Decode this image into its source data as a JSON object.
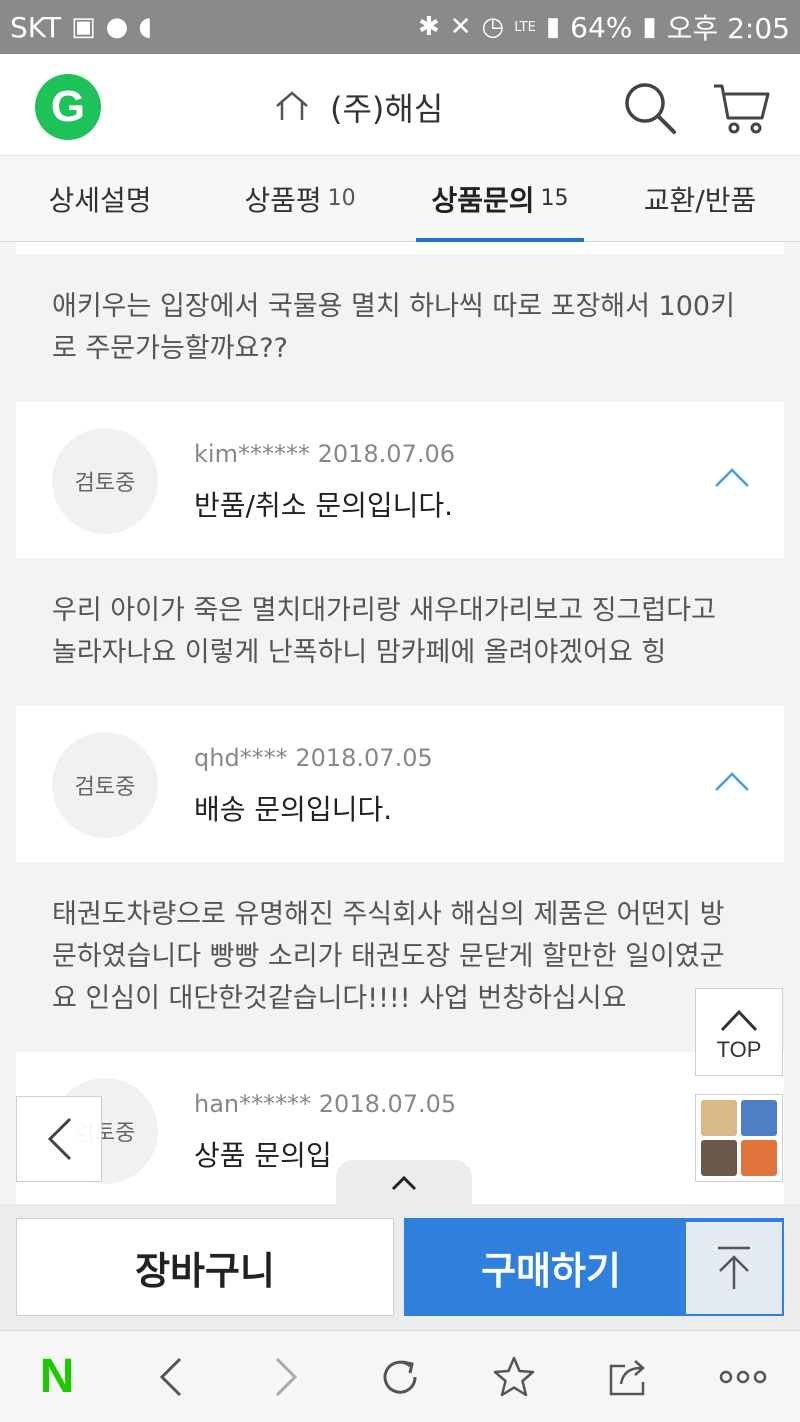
{
  "status_bar": {
    "carrier": "SKT",
    "network": "LTE",
    "battery": "64%",
    "time": "오후 2:05"
  },
  "header": {
    "logo_letter": "G",
    "store_name": "(주)해심"
  },
  "tabs": [
    {
      "label": "상세설명",
      "count": ""
    },
    {
      "label": "상품평",
      "count": "10"
    },
    {
      "label": "상품문의",
      "count": "15",
      "active": true
    },
    {
      "label": "교환/반품",
      "count": ""
    }
  ],
  "qna": {
    "first_answer": "애키우는 입장에서 국물용 멸치 하나씩 따로 포장해서 100키로 주문가능할까요??",
    "items": [
      {
        "status": "검토중",
        "author": "kim******",
        "date": "2018.07.06",
        "subject": "반품/취소 문의입니다.",
        "body": "우리 아이가 죽은 멸치대가리랑 새우대가리보고 징그럽다고 놀라자나요 이렇게 난폭하니 맘카페에 올려야겠어요 힝"
      },
      {
        "status": "검토중",
        "author": "qhd****",
        "date": "2018.07.05",
        "subject": "배송 문의입니다.",
        "body": "태권도차량으로 유명해진 주식회사 해심의 제품은 어떤지 방문하였습니다 빵빵 소리가 태권도장 문닫게 할만한 일이였군요 인심이 대단한것같습니다!!!! 사업 번창하십시요"
      },
      {
        "status": "검토중",
        "author": "han******",
        "date": "2018.07.05",
        "subject": "상품 문의입"
      }
    ]
  },
  "floating": {
    "top_label": "TOP"
  },
  "actions": {
    "cart_label": "장바구니",
    "buy_label": "구매하기"
  },
  "browser_nav": {
    "home_letter": "N"
  },
  "colors": {
    "brand_green": "#1dc25a",
    "accent_blue": "#2f80dc",
    "tab_indicator": "#1f74d4",
    "naver_green": "#1ec800"
  },
  "icons": [
    "home-icon",
    "search-icon",
    "cart-icon",
    "chevron-up-icon",
    "arrow-up-icon",
    "chevron-left-icon",
    "chevron-right-icon",
    "refresh-icon",
    "star-icon",
    "share-icon",
    "more-icon"
  ]
}
